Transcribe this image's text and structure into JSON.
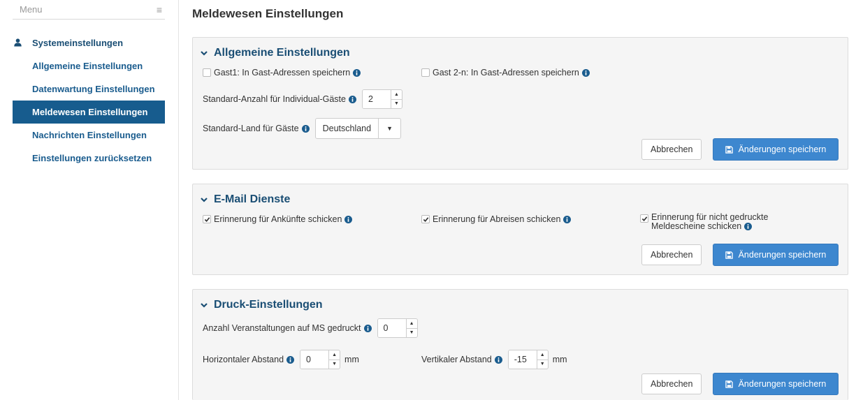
{
  "sidebar": {
    "menu_label": "Menu",
    "section_title": "Systemeinstellungen",
    "items": [
      {
        "label": "Allgemeine Einstellungen"
      },
      {
        "label": "Datenwartung Einstellungen"
      },
      {
        "label": "Meldewesen Einstellungen"
      },
      {
        "label": "Nachrichten Einstellungen"
      },
      {
        "label": "Einstellungen zurücksetzen"
      }
    ],
    "active_item": "Meldewesen Einstellungen"
  },
  "page": {
    "title": "Meldewesen Einstellungen"
  },
  "general": {
    "title": "Allgemeine Einstellungen",
    "gast1_label": "Gast1: In Gast-Adressen speichern",
    "gast1_checked": false,
    "gast2_label": "Gast 2-n: In Gast-Adressen speichern",
    "gast2_checked": false,
    "individual_label": "Standard-Anzahl für Individual-Gäste",
    "individual_value": "2",
    "country_label": "Standard-Land für Gäste",
    "country_value": "Deutschland",
    "cancel_label": "Abbrechen",
    "save_label": "Änderungen speichern"
  },
  "email": {
    "title": "E-Mail Dienste",
    "arrivals_label": "Erinnerung für Ankünfte schicken",
    "arrivals_checked": true,
    "departures_label": "Erinnerung für Abreisen schicken",
    "departures_checked": true,
    "unprinted_label_line1": "Erinnerung für nicht gedruckte",
    "unprinted_label_line2": "Meldescheine schicken",
    "unprinted_checked": true,
    "cancel_label": "Abbrechen",
    "save_label": "Änderungen speichern"
  },
  "print": {
    "title": "Druck-Einstellungen",
    "events_label": "Anzahl Veranstaltungen auf MS gedruckt",
    "events_value": "0",
    "horizontal_label": "Horizontaler Abstand",
    "horizontal_value": "0",
    "vertical_label": "Vertikaler Abstand",
    "vertical_value": "-15",
    "unit": "mm",
    "cancel_label": "Abbrechen",
    "save_label": "Änderungen speichern"
  },
  "icons": {
    "menu": "hamburger-icon",
    "user": "user-icon",
    "chevron": "chevron-down-icon",
    "info": "info-circle-icon",
    "save": "floppy-disk-icon",
    "caret": "caret-down-icon"
  },
  "colors": {
    "nav_text": "#1a5c8e",
    "nav_active_bg": "#175c8e",
    "panel_title": "#1a4e74",
    "primary_button": "#3d87cf",
    "panel_bg": "#f5f5f5"
  }
}
